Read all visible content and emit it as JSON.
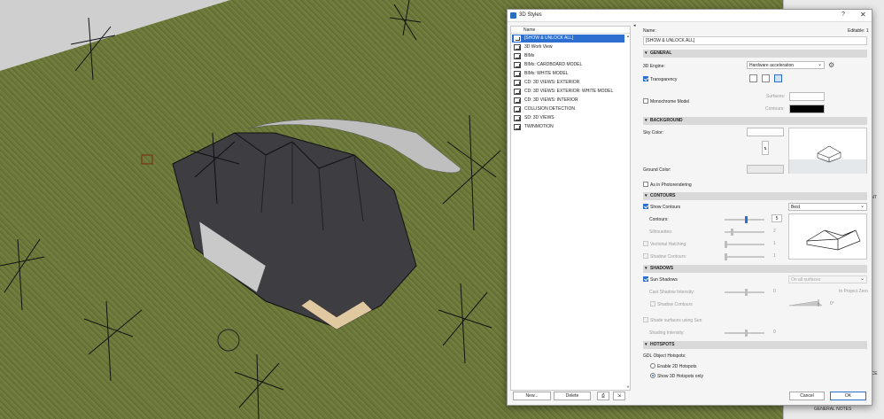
{
  "dialog": {
    "title": "3D Styles",
    "help_label": "?",
    "close_label": "✕",
    "collapse_label": "◂"
  },
  "list": {
    "column_header": "Name",
    "items": [
      "[SHOW & UNLOCK ALL]",
      "3D Work  View",
      "BIMx",
      "BIMx: CARDBOARD MODEL",
      "BIMx: WHITE MODEL",
      "CD: 3D VIEWS: EXTERIOR",
      "CD: 3D VIEWS: EXTERIOR: WHITE MODEL",
      "CD: 3D VIEWS: INTERIOR",
      "COLLISION DETECTION",
      "SD: 3D VIEWS",
      "TWINMOTION"
    ],
    "selected_index": 0,
    "new_label": "New...",
    "delete_label": "Delete",
    "scroll_up": "▲",
    "scroll_down": "▼"
  },
  "settings": {
    "name_label": "Name:",
    "editable_label": "Editable: 1",
    "name_value": "[SHOW & UNLOCK ALL]",
    "general": {
      "header": "GENERAL",
      "engine_label": "3D Engine:",
      "engine_value": "Hardware acceleration",
      "transparency_label": "Transparency",
      "transparency_checked": true,
      "monochrome_label": "Monochrome Model",
      "monochrome_checked": false,
      "surfaces_label": "Surfaces:",
      "contours_label": "Contours:"
    },
    "background": {
      "header": "BACKGROUND",
      "sky_label": "Sky Color:",
      "ground_label": "Ground Color:",
      "swap_label": "⇅",
      "photorender_label": "As in Photorendering",
      "photorender_checked": false
    },
    "contours": {
      "header": "CONTOURS",
      "show_label": "Show Contours",
      "show_checked": true,
      "quality_value": "Best",
      "contours_label": "Contours:",
      "contours_value": "5",
      "contours_level": 0.5,
      "silhouettes_label": "Silhouettes:",
      "silhouettes_value": "2",
      "silhouettes_level": 0.15,
      "vectorial_label": "Vectorial Hatching:",
      "vectorial_value": "1",
      "shadow_contours_label": "Shadow Contours:",
      "shadow_contours_value": "1"
    },
    "shadows": {
      "header": "SHADOWS",
      "sun_label": "Sun Shadows",
      "sun_checked": true,
      "surfaces_value": "On all surfaces",
      "cast_label": "Cast Shadow Intensity:",
      "cast_value": "0",
      "cast_level": 0.5,
      "project_zero_label": "to Project Zero",
      "shadow_contours_label": "Shadow Contours",
      "angle_value": "0°",
      "shade_sun_label": "Shade surfaces using Sun",
      "shading_label": "Shading Intensity:",
      "shading_value": "0",
      "shading_level": 0.5
    },
    "hotspots": {
      "header": "HOTSPOTS",
      "gdl_label": "GDL Object Hotspots:",
      "enable_2d_label": "Enable 2D Hotspots",
      "show_3d_label": "Show 3D Hotspots only",
      "selected": "show_3d"
    },
    "cancel_label": "Cancel",
    "ok_label": "OK"
  },
  "background_panel": {
    "text_1": "ENT",
    "text_2": "NCE",
    "general_notes": "GENERAL NOTES"
  },
  "colors": {
    "accent": "#2d6fd1",
    "grass": "#6b7739",
    "roof": "#3a3a3f"
  }
}
